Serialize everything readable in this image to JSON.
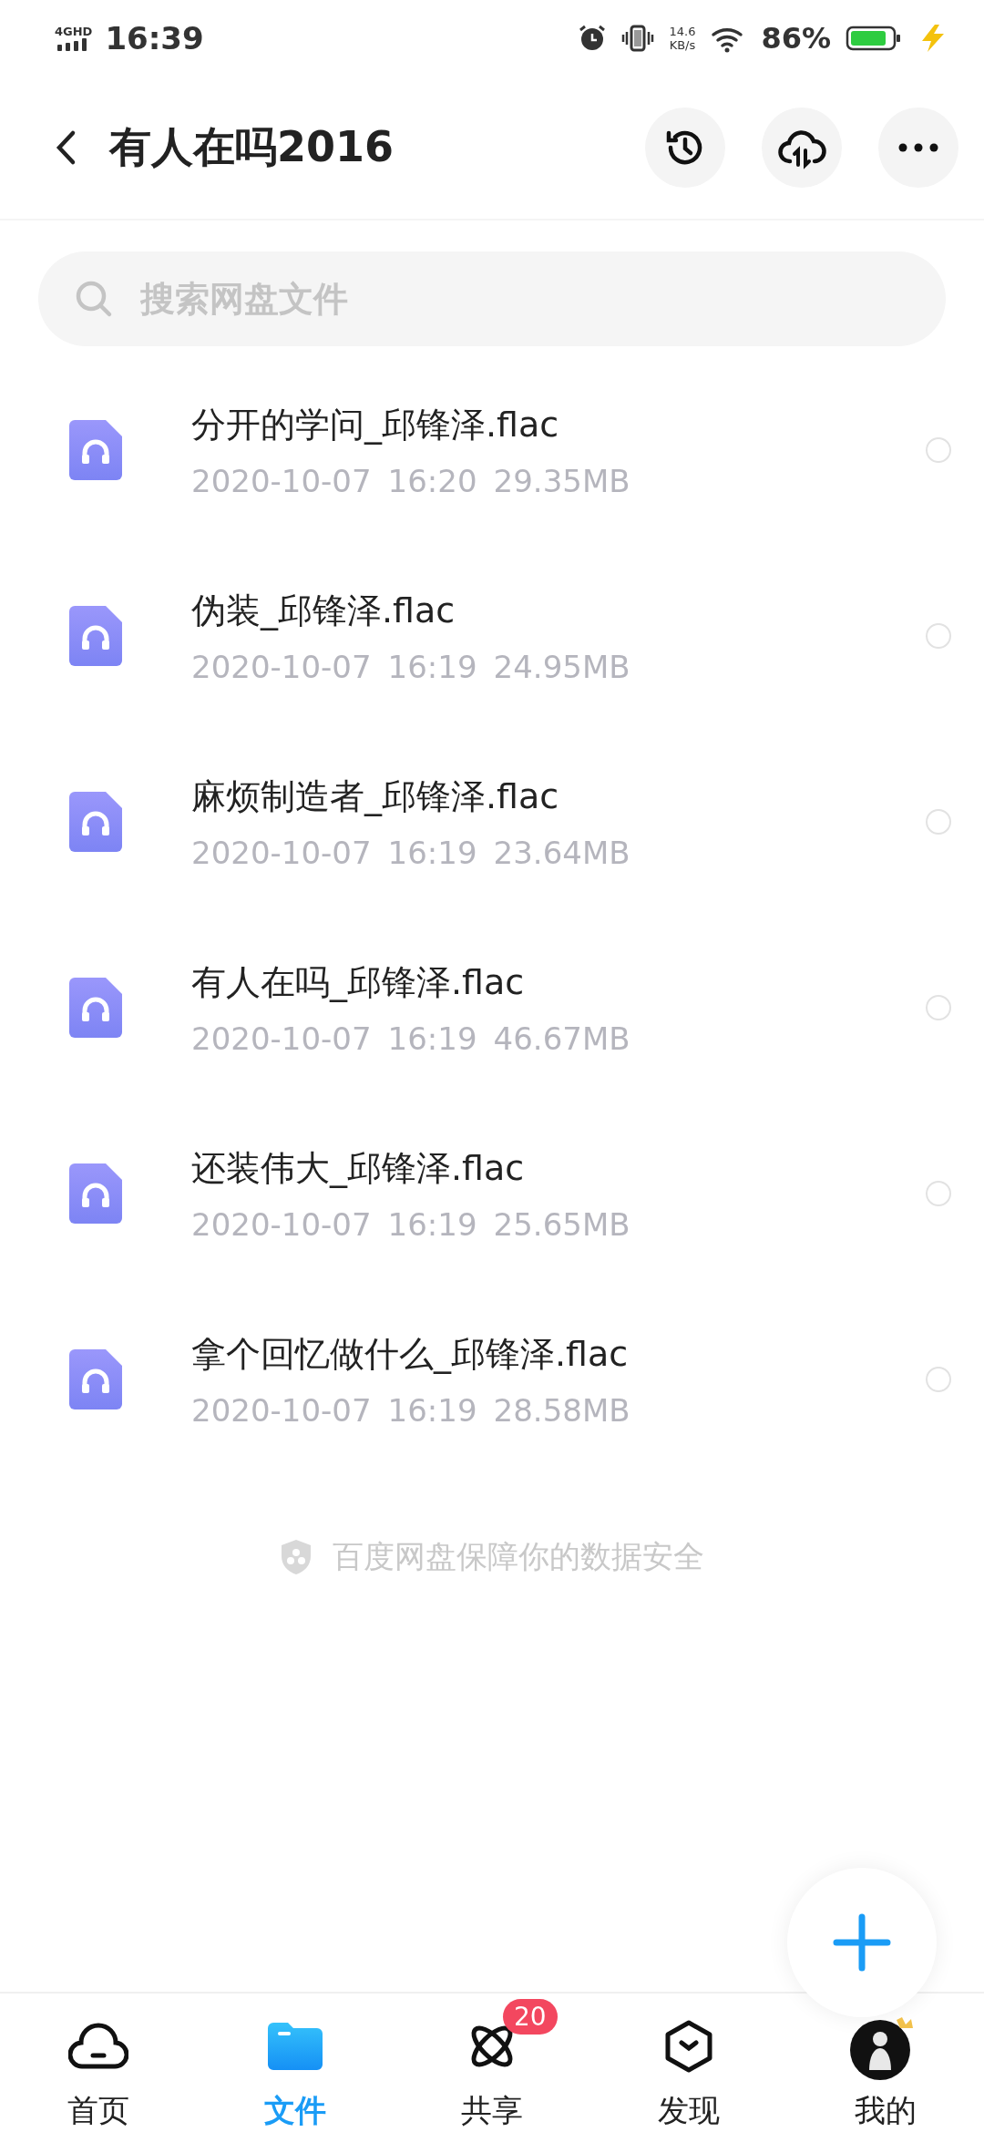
{
  "status_bar": {
    "network": "4GHD",
    "time": "16:39",
    "speed": "14.6",
    "speed_unit": "KB/s",
    "battery": "86%",
    "charging": true
  },
  "header": {
    "title": "有人在吗2016"
  },
  "search": {
    "placeholder": "搜索网盘文件"
  },
  "files": [
    {
      "name": "分开的学问_邱锋泽.flac",
      "date": "2020-10-07",
      "time": "16:20",
      "size": "29.35MB",
      "selected": false
    },
    {
      "name": "伪装_邱锋泽.flac",
      "date": "2020-10-07",
      "time": "16:19",
      "size": "24.95MB",
      "selected": false
    },
    {
      "name": "麻烦制造者_邱锋泽.flac",
      "date": "2020-10-07",
      "time": "16:19",
      "size": "23.64MB",
      "selected": false
    },
    {
      "name": "有人在吗_邱锋泽.flac",
      "date": "2020-10-07",
      "time": "16:19",
      "size": "46.67MB",
      "selected": false
    },
    {
      "name": "还装伟大_邱锋泽.flac",
      "date": "2020-10-07",
      "time": "16:19",
      "size": "25.65MB",
      "selected": false
    },
    {
      "name": "拿个回忆做什么_邱锋泽.flac",
      "date": "2020-10-07",
      "time": "16:19",
      "size": "28.58MB",
      "selected": false
    }
  ],
  "footer_note": "百度网盘保障你的数据安全",
  "nav": [
    {
      "kind": "home",
      "label": "首页",
      "selected": false
    },
    {
      "kind": "files",
      "label": "文件",
      "selected": true
    },
    {
      "kind": "share",
      "label": "共享",
      "selected": false,
      "badge": "20"
    },
    {
      "kind": "discover",
      "label": "发现",
      "selected": false
    },
    {
      "kind": "me",
      "label": "我的",
      "selected": false
    }
  ]
}
